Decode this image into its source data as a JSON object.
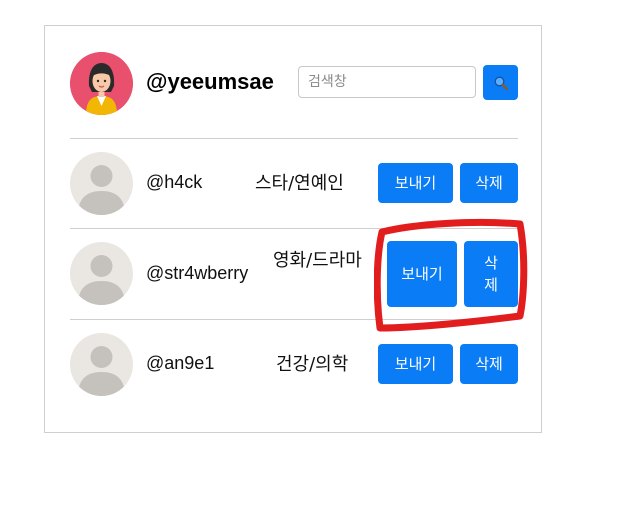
{
  "profile": {
    "username": "@yeeumsae"
  },
  "search": {
    "placeholder": "검색창",
    "value": ""
  },
  "colors": {
    "accent": "#0a7cf6",
    "avatar_bg": "#e9506d",
    "annotation": "#e21d1d"
  },
  "users": [
    {
      "username": "@h4ck",
      "category": "스타/연예인",
      "send_label": "보내기",
      "delete_label": "삭제"
    },
    {
      "username": "@str4wberry",
      "category": "영화/드라마",
      "send_label": "보내기",
      "delete_label": "삭제"
    },
    {
      "username": "@an9e1",
      "category": "건강/의학",
      "send_label": "보내기",
      "delete_label": "삭제"
    }
  ]
}
